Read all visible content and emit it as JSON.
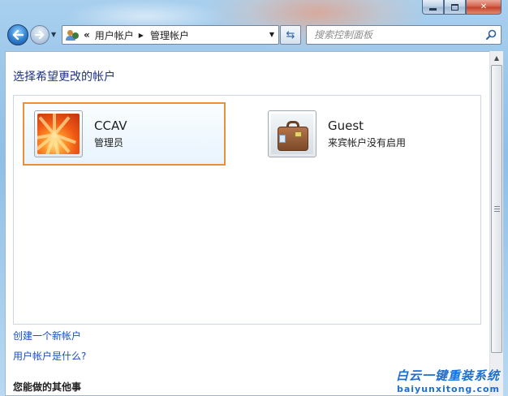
{
  "window": {
    "caption_buttons": [
      "minimize",
      "maximize",
      "close"
    ]
  },
  "toolbar": {
    "back_icon": "back-arrow-icon",
    "forward_icon": "forward-arrow-icon",
    "address": {
      "overflow": "«",
      "crumbs": [
        "用户帐户",
        "管理帐户"
      ]
    },
    "refresh_icon": "refresh-icon",
    "search": {
      "placeholder": "搜索控制面板"
    }
  },
  "content": {
    "title": "选择希望更改的帐户",
    "accounts": [
      {
        "name": "CCAV",
        "role": "管理员",
        "picture": "orange-flower-picture",
        "selected": true
      },
      {
        "name": "Guest",
        "role": "来宾帐户没有启用",
        "picture": "suitcase-picture",
        "selected": false
      }
    ],
    "links": {
      "create": "创建一个新帐户",
      "what_is": "用户帐户是什么?"
    },
    "other_section_title": "您能做的其他事"
  },
  "watermark": {
    "text": "白云一键重装系统",
    "url": "baiyunxitong.com"
  },
  "colors": {
    "selection_border": "#e8903a",
    "link": "#1a4fc4",
    "title": "#1e3287"
  }
}
